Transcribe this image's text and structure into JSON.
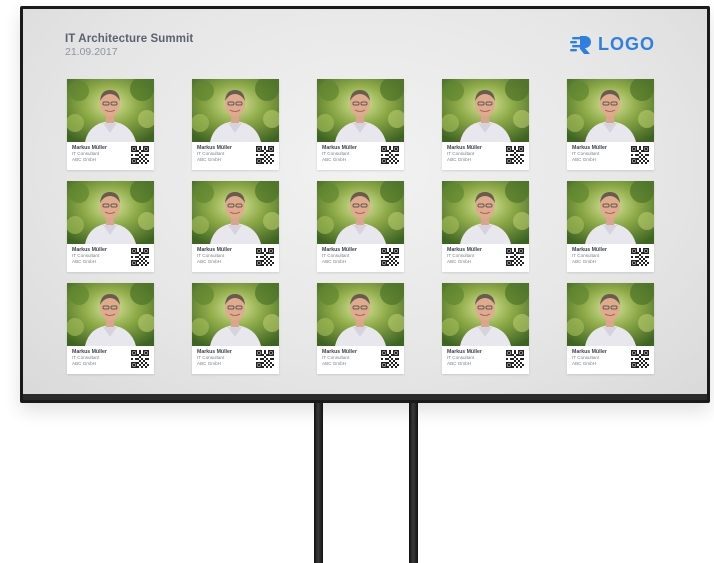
{
  "event": {
    "title": "IT Architecture Summit",
    "date": "21.09.2017"
  },
  "brand": {
    "logo_text": "LOGO",
    "logo_icon": "logo-mark-icon",
    "accent_color": "#2f7fe0"
  },
  "cards": [
    {
      "name": "Markus Müller",
      "role": "IT Consultant",
      "company": "ABC GmbH"
    },
    {
      "name": "Markus Müller",
      "role": "IT Consultant",
      "company": "ABC GmbH"
    },
    {
      "name": "Markus Müller",
      "role": "IT Consultant",
      "company": "ABC GmbH"
    },
    {
      "name": "Markus Müller",
      "role": "IT Consultant",
      "company": "ABC GmbH"
    },
    {
      "name": "Markus Müller",
      "role": "IT Consultant",
      "company": "ABC GmbH"
    },
    {
      "name": "Markus Müller",
      "role": "IT Consultant",
      "company": "ABC GmbH"
    },
    {
      "name": "Markus Müller",
      "role": "IT Consultant",
      "company": "ABC GmbH"
    },
    {
      "name": "Markus Müller",
      "role": "IT Consultant",
      "company": "ABC GmbH"
    },
    {
      "name": "Markus Müller",
      "role": "IT Consultant",
      "company": "ABC GmbH"
    },
    {
      "name": "Markus Müller",
      "role": "IT Consultant",
      "company": "ABC GmbH"
    },
    {
      "name": "Markus Müller",
      "role": "IT Consultant",
      "company": "ABC GmbH"
    },
    {
      "name": "Markus Müller",
      "role": "IT Consultant",
      "company": "ABC GmbH"
    },
    {
      "name": "Markus Müller",
      "role": "IT Consultant",
      "company": "ABC GmbH"
    },
    {
      "name": "Markus Müller",
      "role": "IT Consultant",
      "company": "ABC GmbH"
    },
    {
      "name": "Markus Müller",
      "role": "IT Consultant",
      "company": "ABC GmbH"
    }
  ]
}
